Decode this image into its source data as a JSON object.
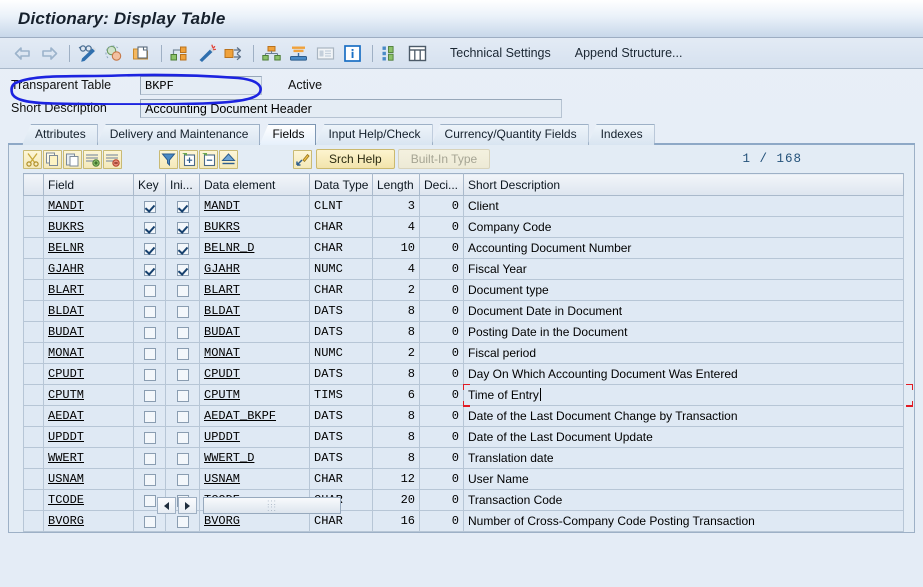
{
  "window": {
    "title": "Dictionary: Display Table"
  },
  "toolbar": {
    "icons": [
      {
        "name": "back-arrow-icon",
        "glyph": "back"
      },
      {
        "name": "forward-arrow-icon",
        "glyph": "forward"
      },
      {
        "name": "display-change-icon",
        "glyph": "glasses-pencil"
      },
      {
        "name": "check-icon",
        "glyph": "check-circles"
      },
      {
        "name": "copy-object-icon",
        "glyph": "copy-folder"
      },
      {
        "name": "where-used-list-icon",
        "glyph": "network-box"
      },
      {
        "name": "activate-icon",
        "glyph": "magic-wand"
      },
      {
        "name": "runtime-object-icon",
        "glyph": "box-arrow"
      },
      {
        "name": "hierarchy-display-icon",
        "glyph": "org-tree"
      },
      {
        "name": "stack-icon",
        "glyph": "stack"
      },
      {
        "name": "documentation-icon",
        "glyph": "doc-lines"
      },
      {
        "name": "info-icon",
        "glyph": "info"
      },
      {
        "name": "indexes-icon",
        "glyph": "blocks"
      },
      {
        "name": "table-contents-icon",
        "glyph": "table-grid"
      }
    ],
    "technical_settings_label": "Technical Settings",
    "append_structure_label": "Append Structure..."
  },
  "header": {
    "table_type_label": "Transparent Table",
    "table_name_value": "BKPF",
    "status_label": "Active",
    "short_description_label": "Short Description",
    "short_description_value": "Accounting Document Header"
  },
  "tabs": [
    {
      "label": "Attributes",
      "active": false
    },
    {
      "label": "Delivery and Maintenance",
      "active": false
    },
    {
      "label": "Fields",
      "active": true
    },
    {
      "label": "Input Help/Check",
      "active": false
    },
    {
      "label": "Currency/Quantity Fields",
      "active": false
    },
    {
      "label": "Indexes",
      "active": false
    }
  ],
  "grid_toolbar": {
    "icons": [
      {
        "name": "cut-icon",
        "glyph": "scissors"
      },
      {
        "name": "copy-icon",
        "glyph": "copy"
      },
      {
        "name": "paste-icon",
        "glyph": "paste"
      },
      {
        "name": "insert-row-icon",
        "glyph": "insert-row"
      },
      {
        "name": "delete-row-icon",
        "glyph": "delete-row"
      },
      {
        "name": "filter-icon",
        "glyph": "filter"
      },
      {
        "name": "expand-icon",
        "glyph": "expand"
      },
      {
        "name": "collapse-icon",
        "glyph": "collapse"
      },
      {
        "name": "sort-ascending-icon",
        "glyph": "sort-up"
      },
      {
        "name": "predefined-type-icon",
        "glyph": "arrow-pencil"
      }
    ],
    "srch_help_label": "Srch Help",
    "built_in_type_label": "Built-In Type",
    "counter": "1 / 168"
  },
  "grid": {
    "columns": [
      "Field",
      "Key",
      "Ini...",
      "Data element",
      "Data Type",
      "Length",
      "Deci...",
      "Short Description"
    ],
    "rows": [
      {
        "field": "MANDT",
        "key": true,
        "init": true,
        "data_element": "MANDT",
        "data_type": "CLNT",
        "length": "3",
        "decimals": "0",
        "description": "Client"
      },
      {
        "field": "BUKRS",
        "key": true,
        "init": true,
        "data_element": "BUKRS",
        "data_type": "CHAR",
        "length": "4",
        "decimals": "0",
        "description": "Company Code"
      },
      {
        "field": "BELNR",
        "key": true,
        "init": true,
        "data_element": "BELNR_D",
        "data_type": "CHAR",
        "length": "10",
        "decimals": "0",
        "description": "Accounting Document Number"
      },
      {
        "field": "GJAHR",
        "key": true,
        "init": true,
        "data_element": "GJAHR",
        "data_type": "NUMC",
        "length": "4",
        "decimals": "0",
        "description": "Fiscal Year"
      },
      {
        "field": "BLART",
        "key": false,
        "init": false,
        "data_element": "BLART",
        "data_type": "CHAR",
        "length": "2",
        "decimals": "0",
        "description": "Document type"
      },
      {
        "field": "BLDAT",
        "key": false,
        "init": false,
        "data_element": "BLDAT",
        "data_type": "DATS",
        "length": "8",
        "decimals": "0",
        "description": "Document Date in Document"
      },
      {
        "field": "BUDAT",
        "key": false,
        "init": false,
        "data_element": "BUDAT",
        "data_type": "DATS",
        "length": "8",
        "decimals": "0",
        "description": "Posting Date in the Document"
      },
      {
        "field": "MONAT",
        "key": false,
        "init": false,
        "data_element": "MONAT",
        "data_type": "NUMC",
        "length": "2",
        "decimals": "0",
        "description": "Fiscal period"
      },
      {
        "field": "CPUDT",
        "key": false,
        "init": false,
        "data_element": "CPUDT",
        "data_type": "DATS",
        "length": "8",
        "decimals": "0",
        "description": "Day On Which Accounting Document Was Entered"
      },
      {
        "field": "CPUTM",
        "key": false,
        "init": false,
        "data_element": "CPUTM",
        "data_type": "TIMS",
        "length": "6",
        "decimals": "0",
        "description": "Time of Entry",
        "focused": true
      },
      {
        "field": "AEDAT",
        "key": false,
        "init": false,
        "data_element": "AEDAT_BKPF",
        "data_type": "DATS",
        "length": "8",
        "decimals": "0",
        "description": "Date of the Last Document Change by Transaction"
      },
      {
        "field": "UPDDT",
        "key": false,
        "init": false,
        "data_element": "UPDDT",
        "data_type": "DATS",
        "length": "8",
        "decimals": "0",
        "description": "Date of the Last Document Update"
      },
      {
        "field": "WWERT",
        "key": false,
        "init": false,
        "data_element": "WWERT_D",
        "data_type": "DATS",
        "length": "8",
        "decimals": "0",
        "description": "Translation date"
      },
      {
        "field": "USNAM",
        "key": false,
        "init": false,
        "data_element": "USNAM",
        "data_type": "CHAR",
        "length": "12",
        "decimals": "0",
        "description": "User Name"
      },
      {
        "field": "TCODE",
        "key": false,
        "init": false,
        "data_element": "TCODE",
        "data_type": "CHAR",
        "length": "20",
        "decimals": "0",
        "description": "Transaction Code"
      },
      {
        "field": "BVORG",
        "key": false,
        "init": false,
        "data_element": "BVORG",
        "data_type": "CHAR",
        "length": "16",
        "decimals": "0",
        "description": "Number of Cross-Company Code Posting Transaction"
      }
    ]
  },
  "annotation": {
    "name": "hand-drawn-blue-highlight",
    "color": "#1c23e0"
  },
  "colors": {
    "title_bar": "#c8d8ea",
    "toolbar": "#dbe5f0",
    "page_background": "#eaf0f8",
    "grid_row": "#dfe9f4",
    "grid_header": "#dde5ef",
    "focus_marker": "#e01b24",
    "accent_button": "#f2e4ac"
  }
}
